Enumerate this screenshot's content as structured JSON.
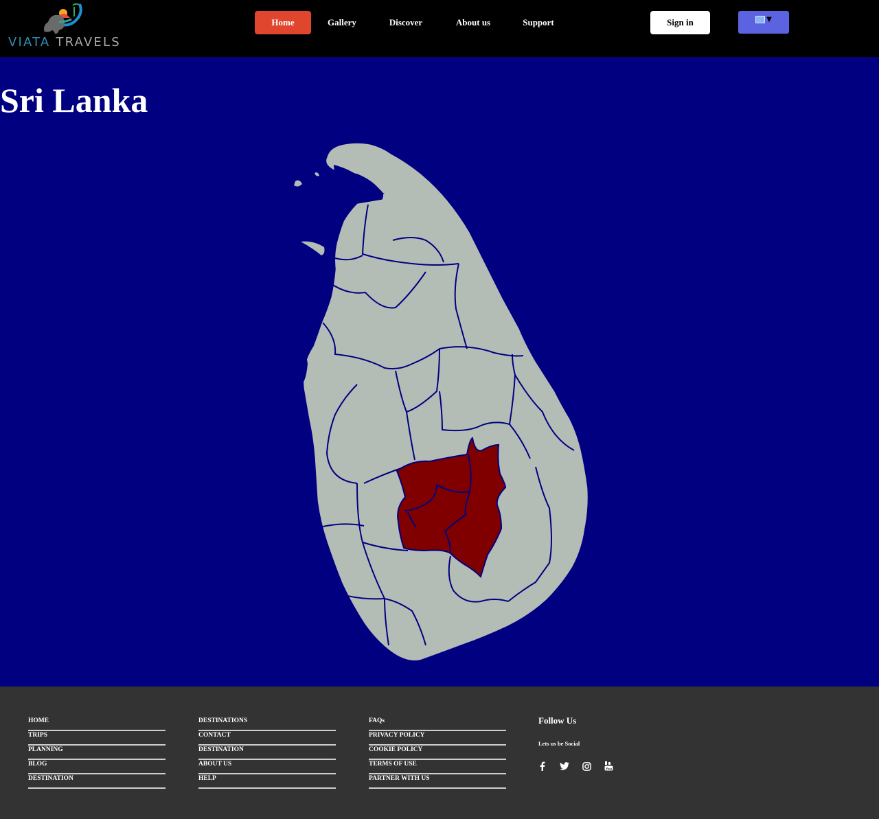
{
  "header": {
    "logo": {
      "word1": "VIATA",
      "word2": " TRAVELS"
    },
    "nav": [
      {
        "label": "Home"
      },
      {
        "label": "Gallery"
      },
      {
        "label": "Discover"
      },
      {
        "label": "About us"
      },
      {
        "label": "Support"
      }
    ],
    "sign_in": "Sign in",
    "language_icon": "translate-icon"
  },
  "main": {
    "title": "Sri Lanka",
    "map": {
      "country": "Sri Lanka",
      "highlight_color": "#800000",
      "land_color": "#b4bcb6",
      "border_color": "#000080"
    }
  },
  "footer": {
    "columns": [
      [
        "HOME",
        "TRIPS",
        "PLANNING",
        "BLOG",
        "DESTINATION"
      ],
      [
        "DESTINATIONS",
        "CONTACT",
        "DESTINATION",
        "ABOUT US",
        "HELP"
      ],
      [
        "FAQs",
        "PRIVACY POLICY",
        "COOKIE POLICY",
        "TERMS OF USE",
        "PARTNER WITH US"
      ]
    ],
    "follow_title": "Follow Us",
    "follow_note": "Lets us be Social",
    "social_icons": [
      "facebook-icon",
      "twitter-icon",
      "instagram-icon",
      "youtube-icon"
    ]
  },
  "colors": {
    "page_background": "#000080",
    "header_background": "#000000",
    "active_nav": "#e0452d",
    "language_button": "#5b63e0",
    "footer_background": "#333333"
  }
}
